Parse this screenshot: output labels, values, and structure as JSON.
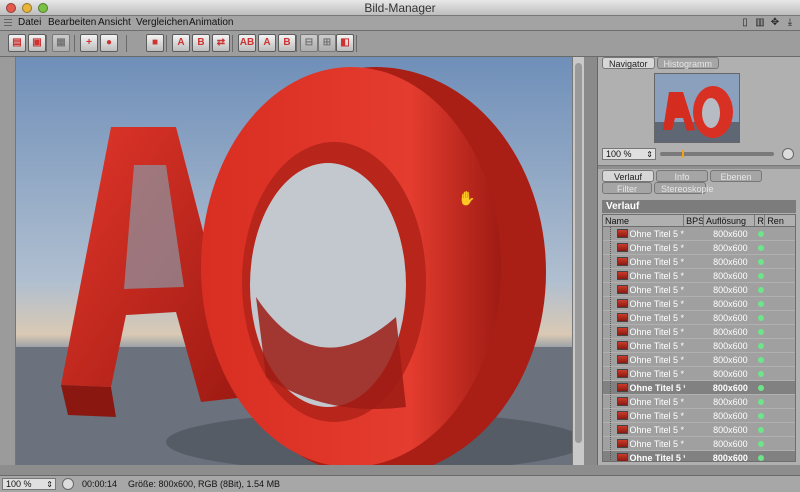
{
  "window": {
    "title": "Bild-Manager"
  },
  "menu": [
    "Datei",
    "Bearbeiten",
    "Ansicht",
    "Vergleichen",
    "Animation"
  ],
  "toolbar": {
    "buttons": [
      {
        "icon": "open-folder-icon",
        "glyph": "▤"
      },
      {
        "icon": "save-icon",
        "glyph": "▣"
      },
      {
        "icon": "grid-icon",
        "glyph": "▦"
      },
      {
        "icon": "render-add-icon",
        "glyph": "+"
      },
      {
        "icon": "render-person-icon",
        "glyph": "●"
      },
      {
        "icon": "render-stop-icon",
        "glyph": "■"
      },
      {
        "icon": "compare-a-icon",
        "glyph": "A"
      },
      {
        "icon": "compare-b-icon",
        "glyph": "B"
      },
      {
        "icon": "compare-swap-icon",
        "glyph": "⇄"
      },
      {
        "icon": "ab-split-icon",
        "glyph": "AB"
      },
      {
        "icon": "set-a-icon",
        "glyph": "A"
      },
      {
        "icon": "set-b-icon",
        "glyph": "B"
      },
      {
        "icon": "split-horizontal-icon",
        "glyph": "⊟"
      },
      {
        "icon": "split-vertical-icon",
        "glyph": "⊞"
      },
      {
        "icon": "filter-icon",
        "glyph": "◧"
      }
    ]
  },
  "navigator": {
    "tabs": [
      "Navigator",
      "Histogramm"
    ],
    "zoom": "100 %",
    "zoom_fraction": 0.19
  },
  "section_tabs": {
    "row1": [
      "Verlauf",
      "Info",
      "Ebenen"
    ],
    "row2": [
      "Filter",
      "Stereoskopie"
    ]
  },
  "history": {
    "header": "Verlauf",
    "columns": [
      "Name",
      "BPS",
      "Auflösung",
      "R",
      "Ren"
    ],
    "rows": [
      {
        "name": "Ohne Titel 5 *",
        "res": "800x600",
        "selected": false
      },
      {
        "name": "Ohne Titel 5 *",
        "res": "800x600",
        "selected": false
      },
      {
        "name": "Ohne Titel 5 *",
        "res": "800x600",
        "selected": false
      },
      {
        "name": "Ohne Titel 5 *",
        "res": "800x600",
        "selected": false
      },
      {
        "name": "Ohne Titel 5 *",
        "res": "800x600",
        "selected": false
      },
      {
        "name": "Ohne Titel 5 *",
        "res": "800x600",
        "selected": false
      },
      {
        "name": "Ohne Titel 5 *",
        "res": "800x600",
        "selected": false
      },
      {
        "name": "Ohne Titel 5 *",
        "res": "800x600",
        "selected": false
      },
      {
        "name": "Ohne Titel 5 *",
        "res": "800x600",
        "selected": false
      },
      {
        "name": "Ohne Titel 5 *",
        "res": "800x600",
        "selected": false
      },
      {
        "name": "Ohne Titel 5 *",
        "res": "800x600",
        "selected": false
      },
      {
        "name": "Ohne Titel 5 *",
        "res": "800x600",
        "selected": true
      },
      {
        "name": "Ohne Titel 5 *",
        "res": "800x600",
        "selected": false
      },
      {
        "name": "Ohne Titel 5 *",
        "res": "800x600",
        "selected": false
      },
      {
        "name": "Ohne Titel 5 *",
        "res": "800x600",
        "selected": false
      },
      {
        "name": "Ohne Titel 5 *",
        "res": "800x600",
        "selected": false
      },
      {
        "name": "Ohne Titel 5 *",
        "res": "800x600",
        "selected": true
      }
    ]
  },
  "status": {
    "zoom": "100 %",
    "time": "00:00:14",
    "info": "Größe: 800x600, RGB (8Bit), 1.54 MB"
  },
  "colors": {
    "accent": "#f0a21a",
    "render_red": "#c8281c",
    "status_green": "#6ee58a"
  }
}
